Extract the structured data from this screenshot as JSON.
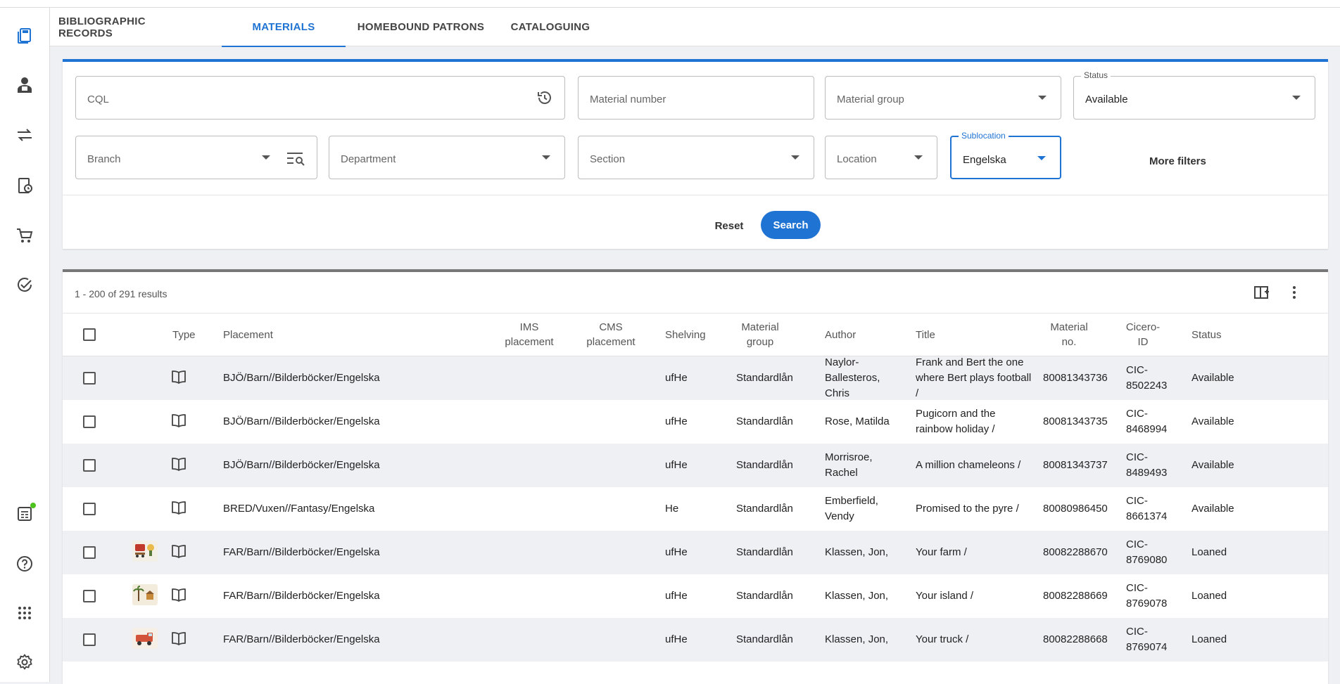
{
  "tabs": [
    {
      "label": "BIBLIOGRAPHIC RECORDS",
      "active": false
    },
    {
      "label": "MATERIALS",
      "active": true
    },
    {
      "label": "HOMEBOUND PATRONS",
      "active": false
    },
    {
      "label": "CATALOGUING",
      "active": false
    }
  ],
  "filters": {
    "cql_placeholder": "CQL",
    "material_number_placeholder": "Material number",
    "material_group_placeholder": "Material group",
    "status_label": "Status",
    "status_value": "Available",
    "branch_placeholder": "Branch",
    "department_placeholder": "Department",
    "section_placeholder": "Section",
    "location_placeholder": "Location",
    "sublocation_label": "Sublocation",
    "sublocation_value": "Engelska",
    "more_filters_label": "More filters",
    "reset_label": "Reset",
    "search_label": "Search"
  },
  "results": {
    "count_text": "1 - 200 of 291 results",
    "headers": {
      "type": "Type",
      "placement": "Placement",
      "ims_placement_1": "IMS",
      "ims_placement_2": "placement",
      "cms_placement_1": "CMS",
      "cms_placement_2": "placement",
      "shelving": "Shelving",
      "material_group_1": "Material",
      "material_group_2": "group",
      "author": "Author",
      "title": "Title",
      "material_no_1": "Material",
      "material_no_2": "no.",
      "cicero_id_1": "Cicero-",
      "cicero_id_2": "ID",
      "status": "Status"
    },
    "rows": [
      {
        "placement": "BJÖ/Barn//Bilderböcker/Engelska",
        "shelving": "ufHe",
        "material_group": "Standardlån",
        "author": "Naylor-Ballesteros, Chris",
        "title": "Frank and Bert the one where Bert plays football /",
        "material_no": "80081343736",
        "cicero_id": "CIC-8502243",
        "status": "Available",
        "thumb": ""
      },
      {
        "placement": "BJÖ/Barn//Bilderböcker/Engelska",
        "shelving": "ufHe",
        "material_group": "Standardlån",
        "author": "Rose, Matilda",
        "title": "Pugicorn and the rainbow holiday /",
        "material_no": "80081343735",
        "cicero_id": "CIC-8468994",
        "status": "Available",
        "thumb": ""
      },
      {
        "placement": "BJÖ/Barn//Bilderböcker/Engelska",
        "shelving": "ufHe",
        "material_group": "Standardlån",
        "author": "Morrisroe, Rachel",
        "title": "A million chameleons /",
        "material_no": "80081343737",
        "cicero_id": "CIC-8489493",
        "status": "Available",
        "thumb": ""
      },
      {
        "placement": "BRED/Vuxen//Fantasy/Engelska",
        "shelving": "He",
        "material_group": "Standardlån",
        "author": "Emberfield, Vendy",
        "title": "Promised to the pyre /",
        "material_no": "80080986450",
        "cicero_id": "CIC-8661374",
        "status": "Available",
        "thumb": ""
      },
      {
        "placement": "FAR/Barn//Bilderböcker/Engelska",
        "shelving": "ufHe",
        "material_group": "Standardlån",
        "author": "Klassen, Jon,",
        "title": "Your farm /",
        "material_no": "80082288670",
        "cicero_id": "CIC-8769080",
        "status": "Loaned",
        "thumb": "farm-cover"
      },
      {
        "placement": "FAR/Barn//Bilderböcker/Engelska",
        "shelving": "ufHe",
        "material_group": "Standardlån",
        "author": "Klassen, Jon,",
        "title": "Your island /",
        "material_no": "80082288669",
        "cicero_id": "CIC-8769078",
        "status": "Loaned",
        "thumb": "island-cover"
      },
      {
        "placement": "FAR/Barn//Bilderböcker/Engelska",
        "shelving": "ufHe",
        "material_group": "Standardlån",
        "author": "Klassen, Jon,",
        "title": "Your truck /",
        "material_no": "80082288668",
        "cicero_id": "CIC-8769074",
        "status": "Loaned",
        "thumb": "truck-cover"
      }
    ]
  },
  "rail_icons": [
    "catalogue-icon",
    "patron-icon",
    "circulation-icon",
    "reservations-icon",
    "acquisitions-icon",
    "tasks-icon",
    "reports-icon",
    "help-icon",
    "apps-icon",
    "settings-icon"
  ],
  "colors": {
    "accent": "#1f73d3",
    "notification": "#4cc21c"
  }
}
